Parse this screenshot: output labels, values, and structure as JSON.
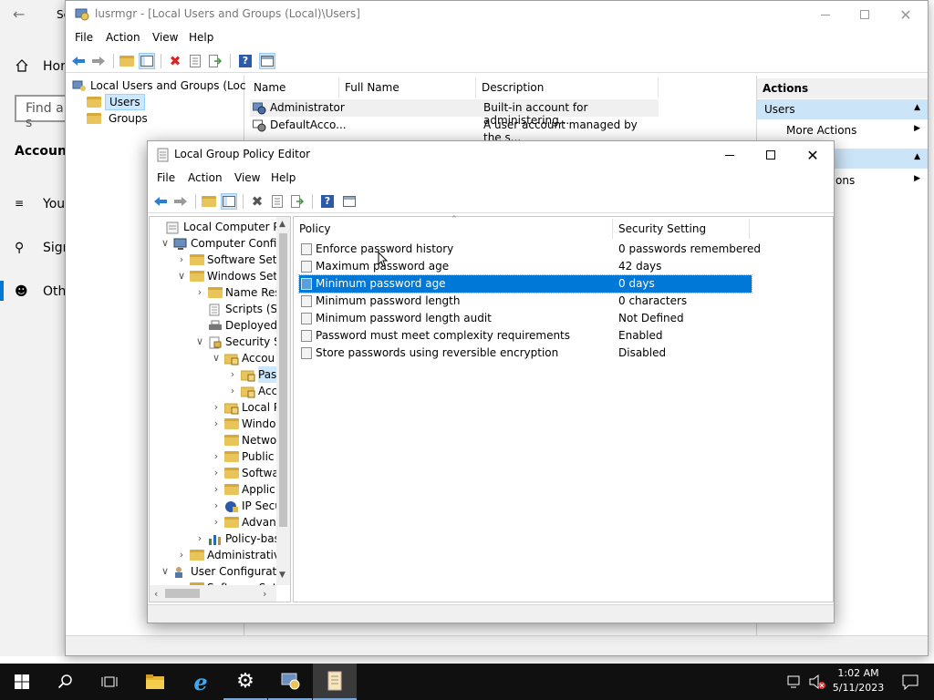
{
  "settings_bg": {
    "title": "Se",
    "home": "Hor",
    "find": "Find a s",
    "section": "Accounts",
    "items": [
      "You",
      "Sign",
      "Oth"
    ]
  },
  "lusrmgr": {
    "title": "lusrmgr - [Local Users and Groups (Local)\\Users]",
    "menu": [
      "File",
      "Action",
      "View",
      "Help"
    ],
    "tree": {
      "root": "Local Users and Groups (Local)",
      "users": "Users",
      "groups": "Groups"
    },
    "columns": [
      "Name",
      "Full Name",
      "Description"
    ],
    "rows": [
      {
        "name": "Administrator",
        "full_name": "",
        "description": "Built-in account for administering..."
      },
      {
        "name": "DefaultAcco...",
        "full_name": "",
        "description": "A user account managed by the s..."
      }
    ],
    "actions": {
      "header": "Actions",
      "section1": "Users",
      "more_actions": "More Actions",
      "more_actions2": "ons"
    }
  },
  "gpedit": {
    "title": "Local Group Policy Editor",
    "menu": [
      "File",
      "Action",
      "View",
      "Help"
    ],
    "tree": [
      {
        "label": "Local Computer Polic",
        "icon": "computer-policy-icon"
      },
      {
        "label": "Computer Config",
        "icon": "computer-icon",
        "chev": "v"
      },
      {
        "label": "Software Setti",
        "icon": "folder-icon",
        "chev": ">"
      },
      {
        "label": "Windows Sett",
        "icon": "folder-icon",
        "chev": "v"
      },
      {
        "label": "Name Res",
        "icon": "folder-icon",
        "chev": ">"
      },
      {
        "label": "Scripts (Sta",
        "icon": "scripts-icon",
        "chev": ""
      },
      {
        "label": "Deployed",
        "icon": "printer-icon",
        "chev": ""
      },
      {
        "label": "Security Se",
        "icon": "security-icon",
        "chev": "v"
      },
      {
        "label": "Accou",
        "icon": "lock-folder-icon",
        "chev": "v"
      },
      {
        "label": "Pas",
        "icon": "lock-folder-icon",
        "chev": ">"
      },
      {
        "label": "Acc",
        "icon": "lock-folder-icon",
        "chev": ">"
      },
      {
        "label": "Local P",
        "icon": "lock-folder-icon",
        "chev": ">"
      },
      {
        "label": "Windo",
        "icon": "folder-icon",
        "chev": ">"
      },
      {
        "label": "Netwo",
        "icon": "folder-icon",
        "chev": ""
      },
      {
        "label": "Public",
        "icon": "folder-icon",
        "chev": ">"
      },
      {
        "label": "Softwa",
        "icon": "folder-icon",
        "chev": ">"
      },
      {
        "label": "Applic",
        "icon": "folder-icon",
        "chev": ">"
      },
      {
        "label": "IP Secu",
        "icon": "ipsec-icon",
        "chev": ">"
      },
      {
        "label": "Advan",
        "icon": "folder-icon",
        "chev": ">"
      },
      {
        "label": "Policy-bas",
        "icon": "chart-icon",
        "chev": ">"
      },
      {
        "label": "Administrative",
        "icon": "folder-icon",
        "chev": ">"
      },
      {
        "label": "User Configuratio",
        "icon": "user-config-icon",
        "chev": "v"
      },
      {
        "label": "Software Setti",
        "icon": "folder-icon",
        "chev": ""
      }
    ],
    "columns": {
      "policy": "Policy",
      "setting": "Security Setting"
    },
    "policies": [
      {
        "policy": "Enforce password history",
        "setting": "0 passwords remembered"
      },
      {
        "policy": "Maximum password age",
        "setting": "42 days"
      },
      {
        "policy": "Minimum password age",
        "setting": "0 days"
      },
      {
        "policy": "Minimum password length",
        "setting": "0 characters"
      },
      {
        "policy": "Minimum password length audit",
        "setting": "Not Defined"
      },
      {
        "policy": "Password must meet complexity requirements",
        "setting": "Enabled"
      },
      {
        "policy": "Store passwords using reversible encryption",
        "setting": "Disabled"
      }
    ],
    "selected_policy": "Minimum password age"
  },
  "taskbar": {
    "time": "1:02 AM",
    "date": "5/11/2023"
  },
  "colors": {
    "taskbar": "#101010",
    "accent": "#0078d7",
    "actions_section": "#cce4f7"
  }
}
